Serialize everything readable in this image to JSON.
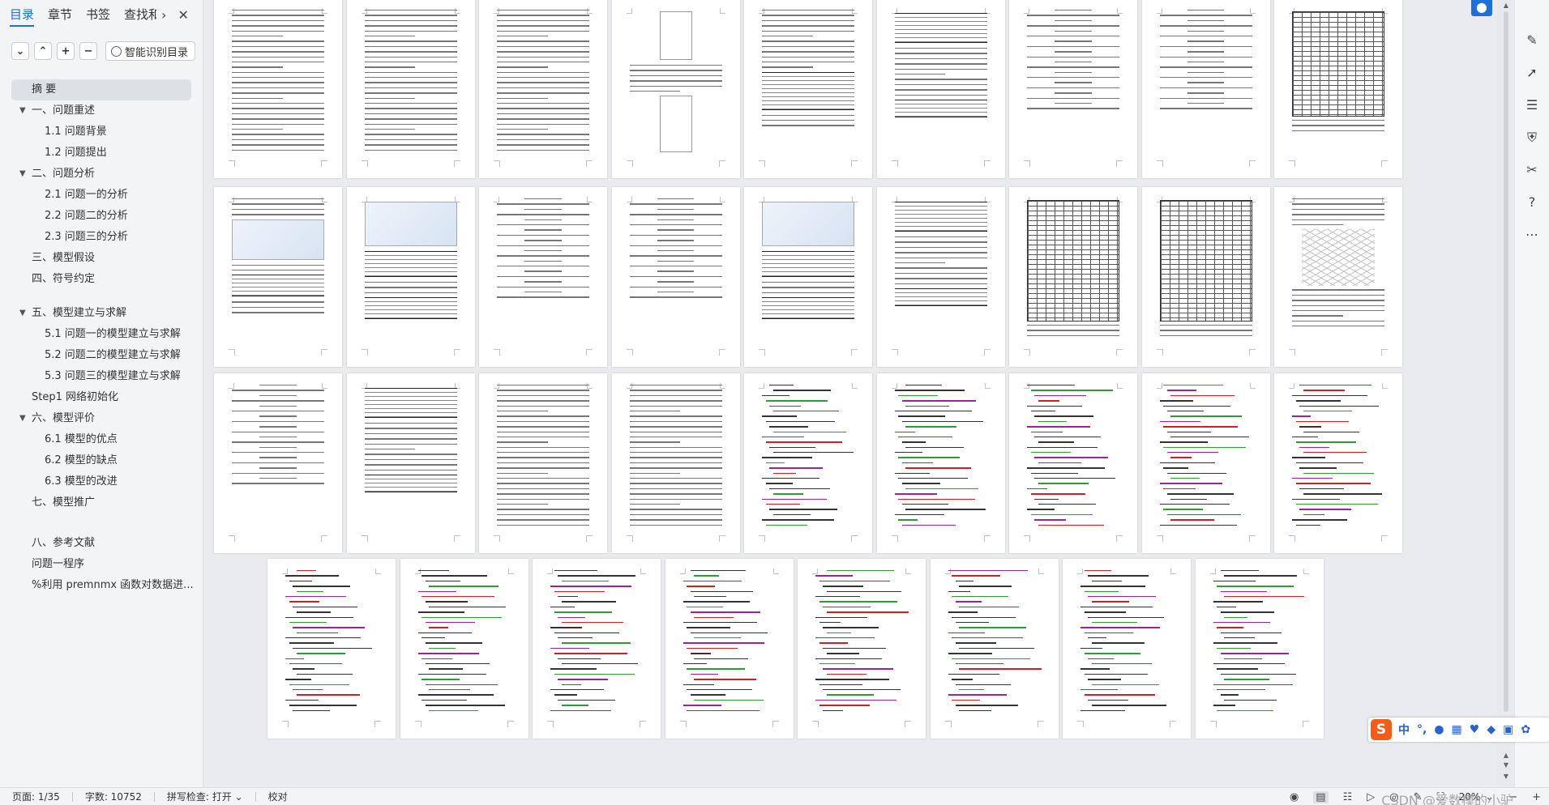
{
  "nav": {
    "tabs": [
      {
        "label": "目录"
      },
      {
        "label": "章节"
      },
      {
        "label": "书签"
      },
      {
        "label": "查找和"
      }
    ],
    "more_icon": "chevron-right-icon",
    "close_icon": "close-icon",
    "tools": {
      "collapse_icon": "chevron-down-icon",
      "expand_icon": "chevron-up-icon",
      "add_icon": "plus-icon",
      "remove_icon": "minus-icon",
      "smart_toc_label": "智能识别目录"
    },
    "toc": [
      {
        "label": "摘  要",
        "level": 1,
        "selected": true
      },
      {
        "label": "一、问题重述",
        "level": 1,
        "caret": "▼"
      },
      {
        "label": "1.1 问题背景",
        "level": 2
      },
      {
        "label": "1.2 问题提出",
        "level": 2
      },
      {
        "label": "二、问题分析",
        "level": 1,
        "caret": "▼"
      },
      {
        "label": "2.1 问题一的分析",
        "level": 2
      },
      {
        "label": "2.2 问题二的分析",
        "level": 2
      },
      {
        "label": "2.3 问题三的分析",
        "level": 2
      },
      {
        "label": "三、模型假设",
        "level": 1
      },
      {
        "label": "四、符号约定",
        "level": 1
      },
      {
        "label": "五、模型建立与求解",
        "level": 1,
        "caret": "▼"
      },
      {
        "label": "5.1 问题一的模型建立与求解",
        "level": 2
      },
      {
        "label": "5.2 问题二的模型建立与求解",
        "level": 2
      },
      {
        "label": "5.3 问题三的模型建立与求解",
        "level": 2
      },
      {
        "label": "Step1 网络初始化",
        "level": 1
      },
      {
        "label": "六、模型评价",
        "level": 1,
        "caret": "▼"
      },
      {
        "label": "6.1 模型的优点",
        "level": 2
      },
      {
        "label": "6.2 模型的缺点",
        "level": 2
      },
      {
        "label": "6.3 模型的改进",
        "level": 2
      },
      {
        "label": "七、模型推广",
        "level": 1
      },
      {
        "label": "八、参考文献",
        "level": 1
      },
      {
        "label": "问题一程序",
        "level": 1
      },
      {
        "label": "%利用 premnmx 函数对数据进...",
        "level": 1
      }
    ]
  },
  "document": {
    "page_count": 35
  },
  "right_bar": {
    "icons": [
      "pen-icon",
      "select-arrow-icon",
      "sliders-icon",
      "shield-icon",
      "tools-icon",
      "help-icon",
      "more-icon"
    ],
    "location_icon": "location-pin-icon"
  },
  "ime": {
    "logo": "S",
    "lang": "中",
    "punct": "°,",
    "icons": [
      "microphone-icon",
      "keyboard-icon",
      "skin-icon",
      "game-icon",
      "apps-icon",
      "settings-icon"
    ]
  },
  "status": {
    "page": "页面: 1/35",
    "words": "字数: 10752",
    "spell": "拼写检查: 打开",
    "proof": "校对",
    "zoom": "20%",
    "watermark": "CSDN @爱数模的小驴"
  },
  "colors": {
    "accent": "#1f6fd6",
    "code_green": "#2e9e2e",
    "code_purple": "#a020a0",
    "code_red": "#d02020"
  }
}
